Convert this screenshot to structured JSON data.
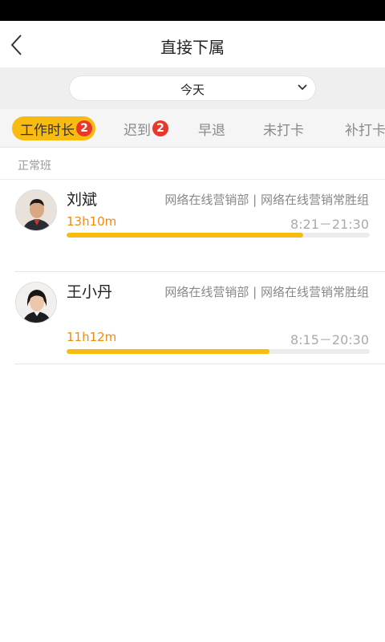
{
  "header": {
    "title": "直接下属"
  },
  "date_filter": {
    "value": "今天"
  },
  "tabs": [
    {
      "label": "工作时长",
      "badge": "2",
      "active": true
    },
    {
      "label": "迟到",
      "badge": "2",
      "active": false
    },
    {
      "label": "早退",
      "active": false
    },
    {
      "label": "未打卡",
      "active": false
    },
    {
      "label": "补打卡",
      "active": false
    }
  ],
  "section": {
    "label": "正常班"
  },
  "people": [
    {
      "name": "刘斌",
      "department": "网络在线营销部 | 网络在线营销常胜组",
      "duration": "13h10m",
      "time_range": "8:21－21:30",
      "progress": 0.78
    },
    {
      "name": "王小丹",
      "department": "网络在线营销部 | 网络在线营销常胜组",
      "duration": "11h12m",
      "time_range": "8:15－20:30",
      "progress": 0.67
    }
  ],
  "colors": {
    "accent": "#f7bb12",
    "badge": "#e8382b",
    "duration_text": "#f28a0c"
  }
}
